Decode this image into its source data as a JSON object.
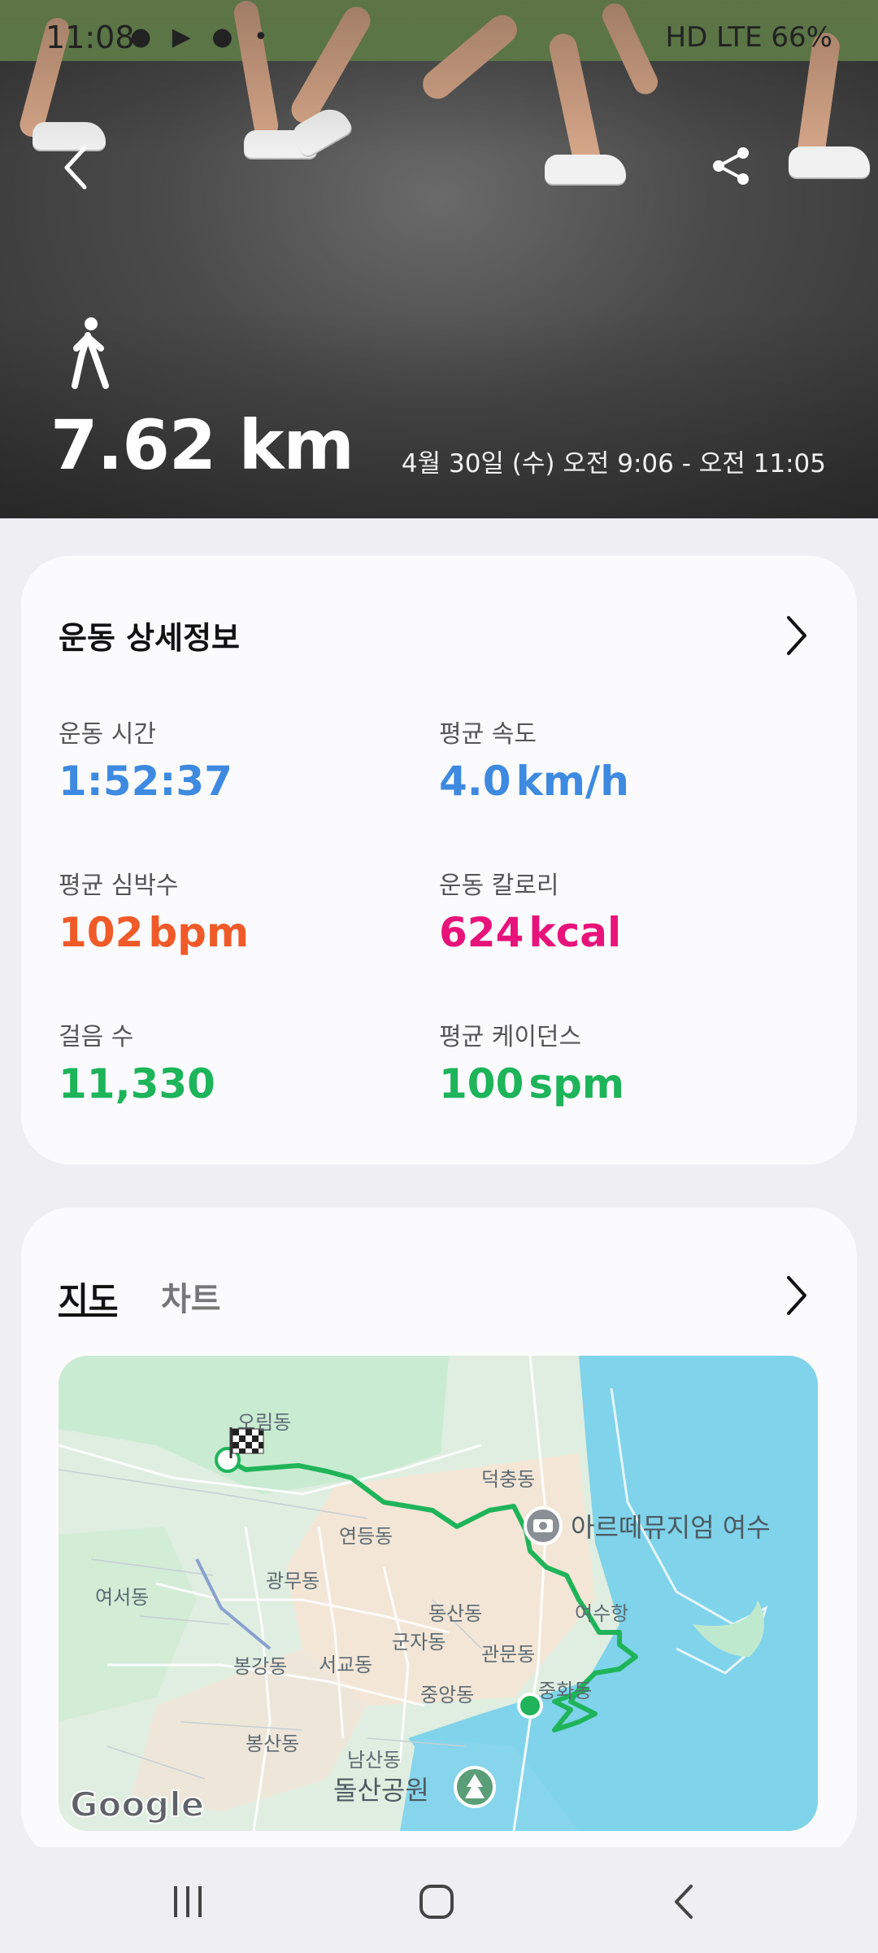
{
  "status_bar": {
    "time": "11:08",
    "right": "HD LTE 66%"
  },
  "header": {
    "distance": "7.62 km",
    "date_range": "4월 30일 (수) 오전 9:06 - 오전 11:05",
    "activity_icon": "walking-icon",
    "back_icon": "chevron-left-icon",
    "share_icon": "share-icon"
  },
  "details": {
    "title": "운동 상세정보",
    "stats": [
      {
        "label": "운동 시간",
        "value": "1:52:37",
        "unit": "",
        "color": "#3d8ae0"
      },
      {
        "label": "평균 속도",
        "value": "4.0",
        "unit": "km/h",
        "color": "#3d8ae0"
      },
      {
        "label": "평균 심박수",
        "value": "102",
        "unit": "bpm",
        "color": "#f05a28"
      },
      {
        "label": "운동 칼로리",
        "value": "624",
        "unit": "kcal",
        "color": "#e8137a"
      },
      {
        "label": "걸음 수",
        "value": "11,330",
        "unit": "",
        "color": "#1db45a"
      },
      {
        "label": "평균 케이던스",
        "value": "100",
        "unit": "spm",
        "color": "#1db45a"
      }
    ]
  },
  "map_section": {
    "tabs": [
      "지도",
      "차트"
    ],
    "active_tab": "지도",
    "labels": {
      "orim": "오림동",
      "deokchung": "덕충동",
      "museum": "아르떼뮤지엄 여수",
      "yeondeung": "연등동",
      "gwangmu": "광무동",
      "yeoseo": "여서동",
      "dongsan": "동산동",
      "yeosuhang": "여수항",
      "gunja": "군자동",
      "gwanmun": "관문동",
      "bonggang": "봉강동",
      "seogyo": "서교동",
      "jungang": "중앙동",
      "junghwa": "중화동",
      "bongsan": "봉산동",
      "namsan": "남산동",
      "dolsan": "돌산공원"
    },
    "google": "Google",
    "route_color": "#1fb45a"
  }
}
